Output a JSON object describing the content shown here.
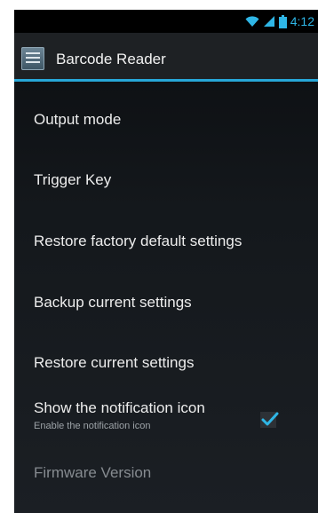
{
  "status_bar": {
    "time": "4:12",
    "icons": [
      "wifi-icon",
      "signal-icon",
      "battery-icon"
    ],
    "accent_color": "#2fb6e6"
  },
  "action_bar": {
    "app_icon": "barcode-app-icon",
    "title": "Barcode Reader",
    "divider_color": "#27a7d8"
  },
  "settings": {
    "items": [
      {
        "title": "Output mode"
      },
      {
        "title": "Trigger Key"
      },
      {
        "title": "Restore factory default settings"
      },
      {
        "title": "Backup current settings"
      },
      {
        "title": "Restore current settings"
      },
      {
        "title": "Show the notification icon",
        "summary": "Enable the notification icon",
        "checked": true
      },
      {
        "title": "Firmware Version",
        "enabled": false
      }
    ]
  }
}
